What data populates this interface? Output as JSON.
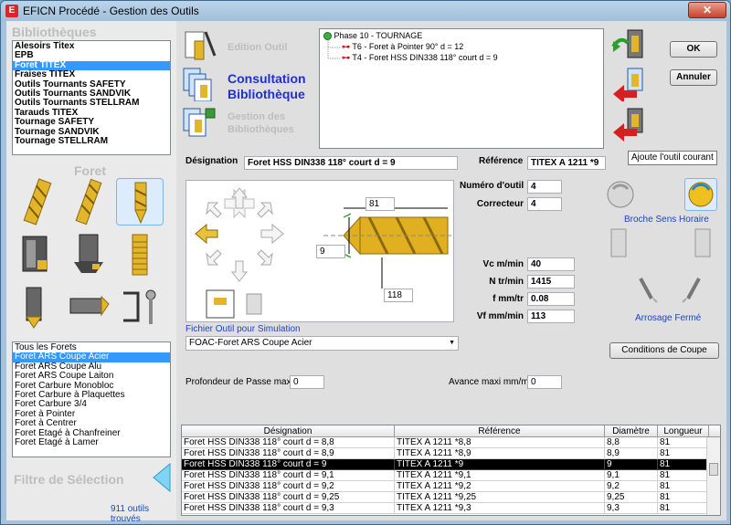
{
  "window": {
    "title": "EFICN Procédé - Gestion des Outils",
    "close_label": "✕"
  },
  "libraries": {
    "title": "Bibliothèques",
    "items": [
      "Alesoirs Titex",
      "EPB",
      "Foret TITEX",
      "Fraises TITEX",
      "Outils Tournants SAFETY",
      "Outils Tournants SANDVIK",
      "Outils Tournants STELLRAM",
      "Tarauds TITEX",
      "Tournage  SAFETY",
      "Tournage SANDVIK",
      "Tournage STELLRAM"
    ],
    "selected_index": 2
  },
  "tool_family": {
    "title": "Foret"
  },
  "tool_types": {
    "items": [
      "Tous les Forets",
      "Foret ARS Coupe Acier",
      "Foret ARS Coupe Alu",
      "Foret ARS Coupe Laiton",
      "Foret Carbure Monobloc",
      "Foret Carbure à Plaquettes",
      "Foret Carbure 3/4",
      "Foret à Pointer",
      "Foret à Centrer",
      "Foret Etagé à Chanfreiner",
      "Foret Etagé à Lamer"
    ],
    "selected_index": 1
  },
  "filter": {
    "title": "Filtre de Sélection",
    "count_text": "911 outils trouvés"
  },
  "actions": {
    "edit": "Edition Outil",
    "consult_line1": "Consultation",
    "consult_line2": "Bibliothèque",
    "manage_line1": "Gestion des",
    "manage_line2": "Bibliothèques"
  },
  "tree": {
    "phase": "Phase 10 - TOURNAGE",
    "tools": [
      "T6 - Foret à Pointer 90° d = 12",
      "T4 - Foret HSS DIN338 118° court d = 9"
    ]
  },
  "buttons": {
    "ok": "OK",
    "cancel": "Annuler",
    "cutting_conditions": "Conditions de Coupe"
  },
  "tooltip": "Ajoute l'outil courant",
  "form": {
    "designation_label": "Désignation",
    "designation_value": "Foret HSS DIN338 118° court d = 9",
    "reference_label": "Référence",
    "reference_value": "TITEX A 1211 *9",
    "tool_number_label": "Numéro d'outil",
    "tool_number_value": "4",
    "corrector_label": "Correcteur",
    "corrector_value": "4",
    "vc_label": "Vc m/min",
    "vc_value": "40",
    "n_label": "N tr/min",
    "n_value": "1415",
    "f_label": "f mm/tr",
    "f_value": "0.08",
    "vf_label": "Vf mm/min",
    "vf_value": "113",
    "depth_label": "Profondeur de Passe maxi",
    "depth_value": "0",
    "feed_label": "Avance maxi mm/min",
    "feed_value": "0"
  },
  "drawing": {
    "dim_length": "81",
    "dim_diameter": "9",
    "dim_flute": "118"
  },
  "sim_file": {
    "label": "Fichier Outil pour Simulation",
    "value": "FOAC-Foret ARS Coupe Acier"
  },
  "spindle": {
    "direction": "Broche Sens Horaire",
    "coolant": "Arrosage Fermé"
  },
  "grid": {
    "headers": [
      "Désignation",
      "Référence",
      "Diamètre",
      "Longueur"
    ],
    "rows": [
      [
        "Foret HSS DIN338 118° court d = 8,8",
        "TITEX A 1211 *8,8",
        "8,8",
        "81"
      ],
      [
        "Foret HSS DIN338 118° court d = 8,9",
        "TITEX A 1211 *8,9",
        "8,9",
        "81"
      ],
      [
        "Foret HSS DIN338 118° court d = 9",
        "TITEX A 1211 *9",
        "9",
        "81"
      ],
      [
        "Foret HSS DIN338 118° court d = 9,1",
        "TITEX A 1211 *9,1",
        "9,1",
        "81"
      ],
      [
        "Foret HSS DIN338 118° court d = 9,2",
        "TITEX A 1211 *9,2",
        "9,2",
        "81"
      ],
      [
        "Foret HSS DIN338 118° court d = 9,25",
        "TITEX A 1211 *9,25",
        "9,25",
        "81"
      ],
      [
        "Foret HSS DIN338 118° court d = 9,3",
        "TITEX A 1211 *9,3",
        "9,3",
        "81"
      ]
    ],
    "selected_index": 2
  },
  "colors": {
    "accent_blue": "#1f2fd6",
    "selection": "#3399ff",
    "drill_gold": "#e0b020"
  }
}
